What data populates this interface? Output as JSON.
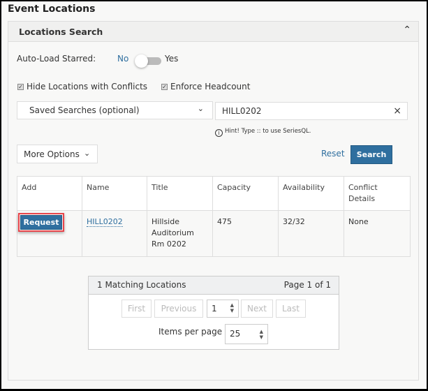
{
  "page_title": "Event Locations",
  "panel": {
    "title": "Locations Search",
    "collapse_icon": "chevron-up-icon"
  },
  "auto_load": {
    "label": "Auto-Load Starred:",
    "off_label": "No",
    "on_label": "Yes",
    "value": false
  },
  "checkboxes": [
    {
      "label": "Hide Locations with Conflicts",
      "checked": true
    },
    {
      "label": "Enforce Headcount",
      "checked": true
    }
  ],
  "saved_searches": {
    "value": "Saved Searches (optional)"
  },
  "search": {
    "value": "HILL0202",
    "clear_icon": "×",
    "hint": "Hint! Type :: to use SeriesQL."
  },
  "more_options": "More Options",
  "reset": "Reset",
  "search_button": "Search",
  "table": {
    "headers": [
      "Add",
      "Name",
      "Title",
      "Capacity",
      "Availability",
      "Conflict Details"
    ],
    "rows": [
      {
        "add": "Request",
        "name": "HILL0202",
        "title": "Hillside Auditorium Rm 0202",
        "capacity": "475",
        "availability": "32/32",
        "conflict": "None"
      }
    ]
  },
  "pagination": {
    "matching": "1 Matching Locations",
    "page_info": "Page 1 of 1",
    "first": "First",
    "previous": "Previous",
    "page": "1",
    "next": "Next",
    "last": "Last",
    "items_label": "Items per page",
    "items_value": "25"
  },
  "colors": {
    "accent": "#2f6f9f",
    "highlight": "#e8454b"
  }
}
